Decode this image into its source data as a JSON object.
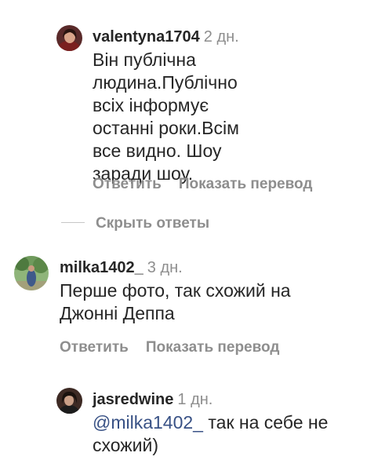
{
  "comments": [
    {
      "username": "valentyna1704",
      "time": "2 дн.",
      "text": "Він публічна людина.Публічно всіх інформує останні роки.Всім все видно. Шоу заради шоу.",
      "reply_label": "Ответить",
      "translate_label": "Показать перевод",
      "avatar_icon": "profile-photo-woman"
    },
    {
      "username": "milka1402_",
      "time": "3 дн.",
      "text": "Перше фото, так схожий на Джонні Деппа",
      "reply_label": "Ответить",
      "translate_label": "Показать перевод",
      "avatar_icon": "profile-photo-outdoor"
    },
    {
      "username": "jasredwine",
      "time": "1 дн.",
      "mention": "@milka1402_",
      "text": " так на себе не схожий)",
      "avatar_icon": "profile-photo-woman"
    }
  ],
  "hide_replies_label": "Скрыть ответы",
  "colors": {
    "text": "#262626",
    "secondary": "#8e8e8e",
    "mention": "#385185",
    "divider": "#c7c7c7"
  }
}
